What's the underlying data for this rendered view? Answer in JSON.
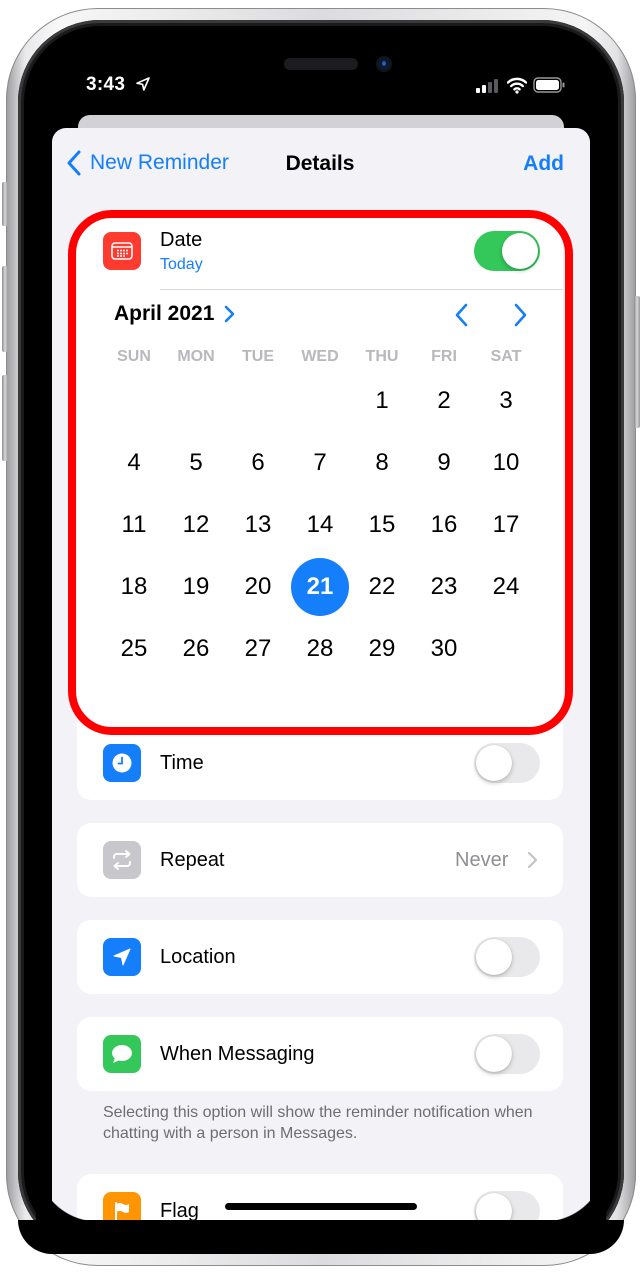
{
  "status_bar": {
    "time": "3:43",
    "icons": [
      "location-arrow-icon",
      "cellular-signal-icon",
      "wifi-icon",
      "battery-icon"
    ]
  },
  "nav": {
    "back_label": "New Reminder",
    "title": "Details",
    "action_label": "Add"
  },
  "date_section": {
    "label": "Date",
    "sublabel": "Today",
    "enabled": true,
    "icon": "calendar-icon",
    "icon_color": "#ff3b30",
    "month_label": "April 2021",
    "weekdays": [
      "SUN",
      "MON",
      "TUE",
      "WED",
      "THU",
      "FRI",
      "SAT"
    ],
    "first_weekday_index": 4,
    "days": [
      "1",
      "2",
      "3",
      "4",
      "5",
      "6",
      "7",
      "8",
      "9",
      "10",
      "11",
      "12",
      "13",
      "14",
      "15",
      "16",
      "17",
      "18",
      "19",
      "20",
      "21",
      "22",
      "23",
      "24",
      "25",
      "26",
      "27",
      "28",
      "29",
      "30"
    ],
    "selected_day": "21"
  },
  "rows": {
    "time": {
      "label": "Time",
      "enabled": false,
      "icon": "clock-icon",
      "icon_color": "#147efb"
    },
    "repeat": {
      "label": "Repeat",
      "value": "Never",
      "icon": "repeat-icon",
      "icon_color": "#c7c7cc"
    },
    "location": {
      "label": "Location",
      "enabled": false,
      "icon": "location-arrow-icon",
      "icon_color": "#147efb"
    },
    "messaging": {
      "label": "When Messaging",
      "enabled": false,
      "icon": "message-bubble-icon",
      "icon_color": "#34c759"
    },
    "flag": {
      "label": "Flag",
      "enabled": false,
      "icon": "flag-icon",
      "icon_color": "#ff9500"
    }
  },
  "messaging_footer": "Selecting this option will show the reminder notification when chatting with a person in Messages.",
  "colors": {
    "accent": "#147efb",
    "toggle_on": "#34c759",
    "highlight_outline": "#ff0000",
    "background": "#f2f2f7"
  }
}
